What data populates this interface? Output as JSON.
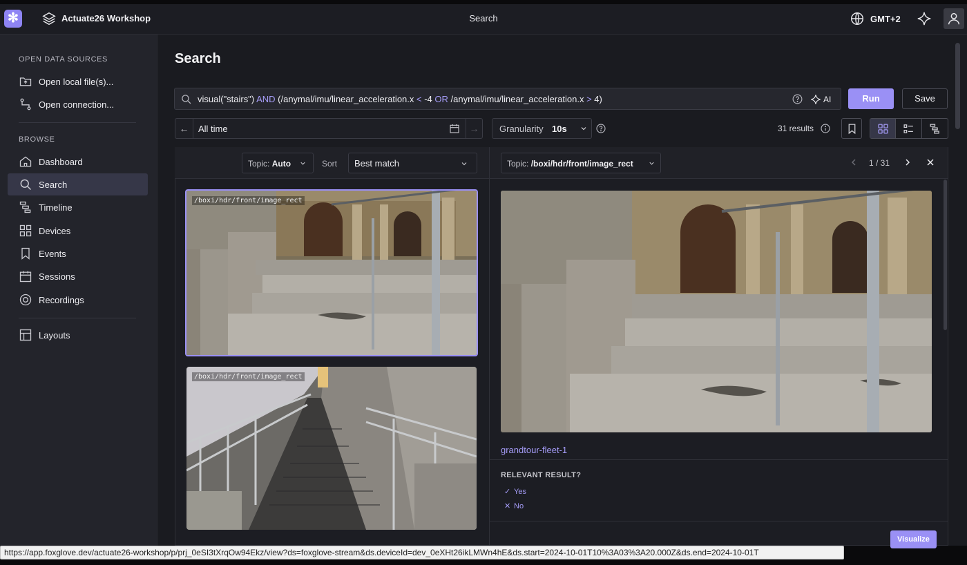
{
  "topbar": {
    "workspace": "Actuate26 Workshop",
    "title": "Search",
    "timezone": "GMT+2"
  },
  "sidebar": {
    "open_heading": "OPEN DATA SOURCES",
    "open_items": [
      {
        "label": "Open local file(s)...",
        "icon": "folder-open-icon"
      },
      {
        "label": "Open connection...",
        "icon": "connection-icon"
      }
    ],
    "browse_heading": "BROWSE",
    "browse_items": [
      {
        "label": "Dashboard",
        "icon": "home-icon"
      },
      {
        "label": "Search",
        "icon": "search-icon",
        "active": true
      },
      {
        "label": "Timeline",
        "icon": "timeline-icon"
      },
      {
        "label": "Devices",
        "icon": "devices-icon"
      },
      {
        "label": "Events",
        "icon": "bookmark-icon"
      },
      {
        "label": "Sessions",
        "icon": "calendar-icon"
      },
      {
        "label": "Recordings",
        "icon": "recording-icon"
      }
    ],
    "layouts_label": "Layouts"
  },
  "page": {
    "title": "Search"
  },
  "search": {
    "q1": "visual(\"stairs\") ",
    "q2": "AND",
    "q3": " (/anymal/imu/linear_acceleration.x ",
    "q4": "<",
    "q5": " -4 ",
    "q6": "OR",
    "q7": " /anymal/imu/linear_acceleration.x ",
    "q8": ">",
    "q9": " 4)",
    "ai_label": "AI",
    "run_label": "Run",
    "save_label": "Save"
  },
  "filters": {
    "time_range": "All time",
    "granularity_label": "Granularity",
    "granularity_value": "10s",
    "results_count": "31 results"
  },
  "results_list": {
    "topic_label": "Topic:",
    "topic_value": "Auto",
    "sort_label": "Sort",
    "sort_value": "Best match",
    "items": [
      {
        "topic": "/boxi/hdr/front/image_rect",
        "selected": true
      },
      {
        "topic": "/boxi/hdr/front/image_rect",
        "selected": false
      }
    ]
  },
  "detail": {
    "topic_label": "Topic:",
    "topic_value": "/boxi/hdr/front/image_rect",
    "pager": "1 / 31",
    "device": "grandtour-fleet-1",
    "relevant_question": "RELEVANT RESULT?",
    "yes_label": "Yes",
    "no_label": "No",
    "visualize_label": "Visualize"
  },
  "statusbar": {
    "url": "https://app.foxglove.dev/actuate26-workshop/p/prj_0eSI3tXrqOw94Ekz/view?ds=foxglove-stream&ds.deviceId=dev_0eXHt26ikLMWn4hE&ds.start=2024-10-01T10%3A03%3A20.000Z&ds.end=2024-10-01T"
  },
  "colors": {
    "accent": "#9a90f5",
    "link": "#a59cf7",
    "background": "#1a1b20",
    "sidebar": "#23242b"
  }
}
